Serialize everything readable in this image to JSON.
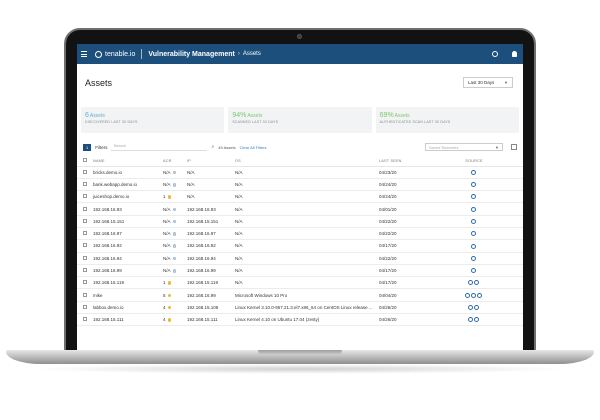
{
  "colors": {
    "header_bg": "#1d4f7c",
    "accent": "#3a7cc0",
    "teal": "#5bb5c9",
    "green": "#7bc96f",
    "warn": "#e8b93b"
  },
  "topbar": {
    "brand": "tenable.io",
    "title": "Vulnerability Management",
    "breadcrumb_sep": "›",
    "breadcrumb": "Assets"
  },
  "page": {
    "title": "Assets",
    "range_select": "Last 30 Days"
  },
  "cards": [
    {
      "value": "6",
      "unit": "Assets",
      "label": "DISCOVERED LAST 30 DAYS",
      "color": "#5bb5c9"
    },
    {
      "value": "94%",
      "unit": "Assets",
      "label": "SCANNED LAST 30 DAYS",
      "color": "#7bc96f"
    },
    {
      "value": "69%",
      "unit": "Assets",
      "label": "AUTHENTICATED SCAN LAST 30 DAYS",
      "color": "#7bc96f"
    }
  ],
  "filter_bar": {
    "count": "1",
    "filters_label": "Filters",
    "search_placeholder": "Search",
    "asset_count": "49 Assets",
    "clear_all": "Clear All Filters",
    "saved_search_placeholder": "Saved Searches"
  },
  "table": {
    "columns": [
      "NAME",
      "ACR",
      "IP",
      "OS",
      "LAST SEEN",
      "SOURCE"
    ],
    "rows": [
      {
        "name": "bricks.demo.io",
        "acr": "N/A",
        "acr_icon": "none",
        "ip": "N/A",
        "os": "N/A",
        "last_seen": "04/23/20",
        "sources": 1
      },
      {
        "name": "bank.webapp.demo.io",
        "acr": "N/A",
        "acr_icon": "none",
        "ip": "N/A",
        "os": "N/A",
        "last_seen": "04/24/20",
        "sources": 1
      },
      {
        "name": "juiceshop.demo.io",
        "acr": "1",
        "acr_icon": "warn",
        "ip": "N/A",
        "os": "N/A",
        "last_seen": "04/24/20",
        "sources": 1
      },
      {
        "name": "192.168.16.93",
        "acr": "N/A",
        "acr_icon": "none",
        "ip": "192.168.16.93",
        "os": "N/A",
        "last_seen": "04/01/20",
        "sources": 1
      },
      {
        "name": "192.168.15.151",
        "acr": "N/A",
        "acr_icon": "none",
        "ip": "192.168.15.151",
        "os": "N/A",
        "last_seen": "04/22/20",
        "sources": 1
      },
      {
        "name": "192.168.16.97",
        "acr": "N/A",
        "acr_icon": "none",
        "ip": "192.168.16.97",
        "os": "N/A",
        "last_seen": "04/22/20",
        "sources": 1
      },
      {
        "name": "192.168.16.92",
        "acr": "N/A",
        "acr_icon": "none",
        "ip": "192.168.16.92",
        "os": "N/A",
        "last_seen": "04/17/20",
        "sources": 1
      },
      {
        "name": "192.168.16.94",
        "acr": "N/A",
        "acr_icon": "none",
        "ip": "192.168.16.94",
        "os": "N/A",
        "last_seen": "04/22/20",
        "sources": 1
      },
      {
        "name": "192.168.16.99",
        "acr": "N/A",
        "acr_icon": "none",
        "ip": "192.168.16.99",
        "os": "N/A",
        "last_seen": "04/17/20",
        "sources": 1
      },
      {
        "name": "192.168.15.119",
        "acr": "1",
        "acr_icon": "warn",
        "ip": "192.168.15.119",
        "os": "N/A",
        "last_seen": "04/17/20",
        "sources": 2
      },
      {
        "name": "mike",
        "acr": "5",
        "acr_icon": "warn",
        "ip": "192.168.16.99",
        "os": "Microsoft Windows 10 Pro",
        "last_seen": "04/04/20",
        "sources": 3
      },
      {
        "name": "labbox.demo.io",
        "acr": "4",
        "acr_icon": "warn",
        "ip": "192.168.15.108",
        "os": "Linux Kernel 3.10.0-957.21.3.el7.x86_64 on CentOS Linux release ...",
        "last_seen": "04/26/20",
        "sources": 2
      },
      {
        "name": "192.168.15.111",
        "acr": "4",
        "acr_icon": "warn",
        "ip": "192.168.15.111",
        "os": "Linux Kernel 4.10 on Ubuntu 17.04 (zesty)",
        "last_seen": "04/26/20",
        "sources": 2
      }
    ]
  }
}
